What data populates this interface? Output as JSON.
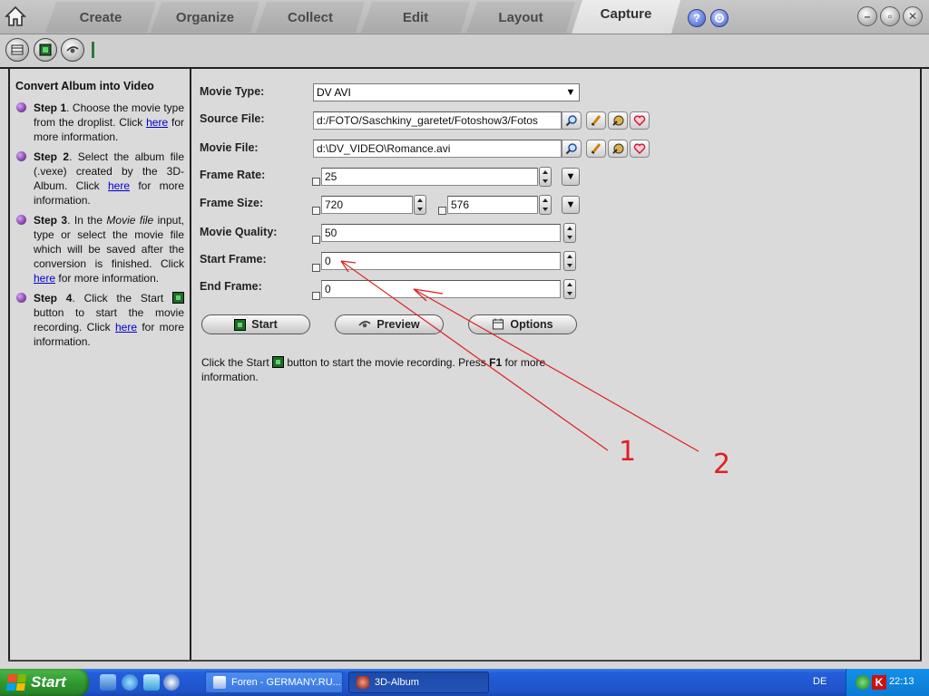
{
  "tabs": [
    {
      "label": "Create",
      "active": false
    },
    {
      "label": "Organize",
      "active": false
    },
    {
      "label": "Collect",
      "active": false
    },
    {
      "label": "Edit",
      "active": false
    },
    {
      "label": "Layout",
      "active": false
    },
    {
      "label": "Capture",
      "active": true
    }
  ],
  "window_buttons": {
    "help": "?",
    "minimize": "–",
    "restore": "▫",
    "close": "✕"
  },
  "left_panel": {
    "title": "Convert Album into Video",
    "steps": [
      {
        "label": "Step 1",
        "text_a": ". Choose the movie type from the droplist. Click ",
        "link": "here",
        "text_b": " for more information."
      },
      {
        "label": "Step 2",
        "text_a": ". Select the album file (.vexe) created by the 3D-Album. Click ",
        "link": "here",
        "text_b": " for more information."
      },
      {
        "label": "Step 3",
        "text_pre": ". In the ",
        "italic": "Movie file",
        "text_a": " input, type or select the movie file which will be saved after the conversion is finished. Click ",
        "link": "here",
        "text_b": " for more information."
      },
      {
        "label": "Step 4",
        "text_a": ". Click the Start ",
        "text_mid": " button to start the movie recording. Click ",
        "link": "here",
        "text_b": " for more information."
      }
    ]
  },
  "form": {
    "movie_type": {
      "label": "Movie Type:",
      "value": "DV AVI"
    },
    "source_file": {
      "label": "Source File:",
      "value": "d:/FOTO/Saschkiny_garetet/Fotoshow3/Fotos"
    },
    "movie_file": {
      "label": "Movie File:",
      "value": "d:\\DV_VIDEO\\Romance.avi"
    },
    "frame_rate": {
      "label": "Frame Rate:",
      "value": "25"
    },
    "frame_size": {
      "label": "Frame Size:",
      "width": "720",
      "height": "576"
    },
    "movie_quality": {
      "label": "Movie Quality:",
      "value": "50"
    },
    "start_frame": {
      "label": "Start Frame:",
      "value": "0"
    },
    "end_frame": {
      "label": "End Frame:",
      "value": "0"
    }
  },
  "buttons": {
    "start": "Start",
    "preview": "Preview",
    "options": "Options"
  },
  "info": {
    "text_a": "Click the Start ",
    "text_b": " button to start the movie recording. Press ",
    "key": "F1",
    "text_c": " for more information."
  },
  "annotations": {
    "label_1": "1",
    "label_2": "2",
    "color": "#e02020"
  },
  "taskbar": {
    "start_label": "Start",
    "items": [
      {
        "label": "Foren - GERMANY.RU...",
        "active": false
      },
      {
        "label": "3D-Album",
        "active": true
      }
    ],
    "language": "DE",
    "clock": "22:13"
  }
}
